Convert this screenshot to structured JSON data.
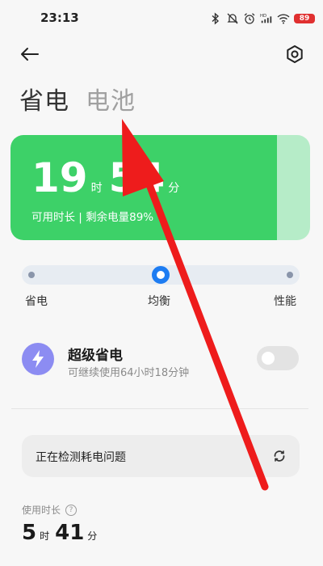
{
  "status_bar": {
    "time": "23:13",
    "icons": [
      "bluetooth-icon",
      "mute-icon",
      "alarm-icon",
      "hd-signal-icon",
      "wifi-icon"
    ],
    "battery_text": "89"
  },
  "topbar": {
    "back_icon": "arrow-left-icon",
    "settings_icon": "gear-icon"
  },
  "tabs": [
    {
      "label": "省电",
      "active": true
    },
    {
      "label": "电池",
      "active": false
    }
  ],
  "battery_card": {
    "hours": "19",
    "hours_unit": "时",
    "minutes": "54",
    "minutes_unit": "分",
    "subtitle": "可用时长 | 剩余电量89%",
    "level_fraction": 0.89,
    "fill_color": "#3dd168",
    "track_color": "#b6ecc8"
  },
  "mode_slider": {
    "options": [
      "省电",
      "均衡",
      "性能"
    ],
    "selected": "均衡",
    "accent_color": "#1d7cf2"
  },
  "super_saver": {
    "title": "超级省电",
    "subtitle": "可继续使用64小时18分钟",
    "icon": "lightning-icon",
    "icon_color": "#8c8cf2",
    "enabled": false
  },
  "check": {
    "label": "正在检测耗电问题",
    "icon": "refresh-icon"
  },
  "usage": {
    "label": "使用时长",
    "help_glyph": "?",
    "hours": "5",
    "hours_unit": "时",
    "minutes": "41",
    "minutes_unit": "分"
  }
}
